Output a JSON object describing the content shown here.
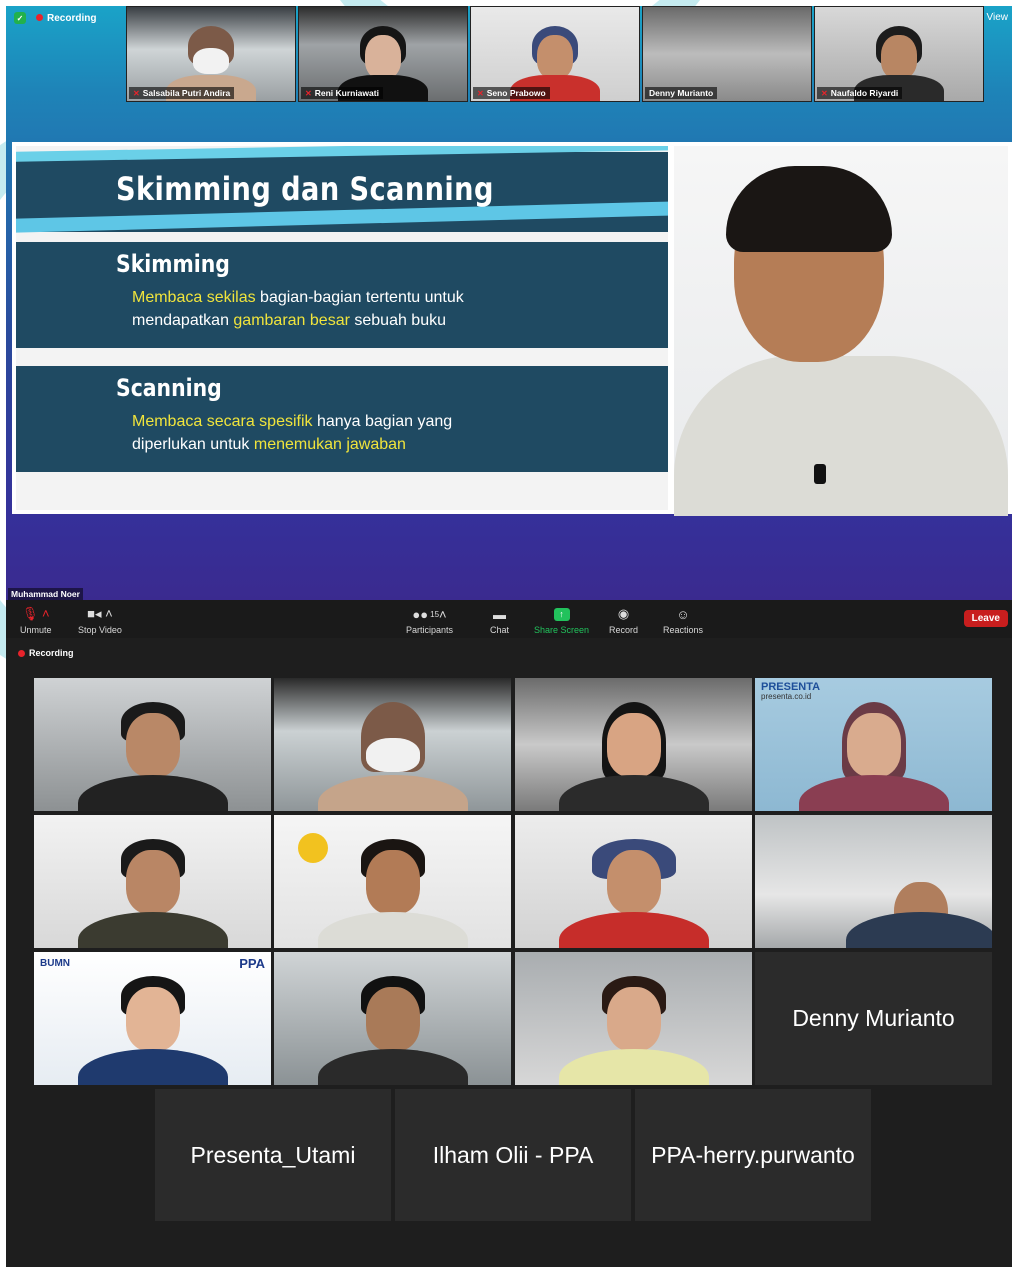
{
  "meeting_top": {
    "recording_label": "Recording",
    "view_label": "View",
    "thumbnails": [
      {
        "name": "Salsabila Putri Andira",
        "muted": true
      },
      {
        "name": "Reni Kurniawati",
        "muted": true
      },
      {
        "name": "Seno Prabowo",
        "muted": true
      },
      {
        "name": "Denny Murianto",
        "muted": false
      },
      {
        "name": "Naufaldo Riyardi",
        "muted": true
      }
    ],
    "slide": {
      "title": "Skimming dan Scanning",
      "sections": [
        {
          "heading": "Skimming",
          "line1_hl": "Membaca sekilas",
          "line1_rest": " bagian-bagian tertentu untuk",
          "line2_pre": "mendapatkan ",
          "line2_hl": "gambaran besar",
          "line2_rest": " sebuah buku"
        },
        {
          "heading": "Scanning",
          "line1_hl": "Membaca secara spesifik",
          "line1_rest": " hanya bagian yang",
          "line2_pre": "diperlukan untuk ",
          "line2_hl": "menemukan jawaban",
          "line2_rest": ""
        }
      ]
    },
    "presenter_name": "Muhammad Noer"
  },
  "toolbar": {
    "unmute": "Unmute",
    "stop_video": "Stop Video",
    "participants": "Participants",
    "participants_count": "15",
    "chat": "Chat",
    "share_screen": "Share Screen",
    "record": "Record",
    "reactions": "Reactions",
    "leave": "Leave"
  },
  "meeting_bottom": {
    "recording_label": "Recording",
    "presenta_logo": "PRESENTA",
    "presenta_url": "presenta.co.id",
    "bumn_logo": "BUMN",
    "ppa_logo": "PPA",
    "name_tiles": [
      "Denny Murianto",
      "Presenta_Utami",
      "Ilham Olii - PPA",
      "PPA-herry.purwanto"
    ]
  },
  "colors": {
    "recording_red": "#e8232b",
    "share_green": "#22c25c",
    "leave_red": "#c81e1e",
    "active_speaker": "#c8e04a",
    "slide_navy": "#1f4a62",
    "highlight_yellow": "#f0e43c"
  }
}
